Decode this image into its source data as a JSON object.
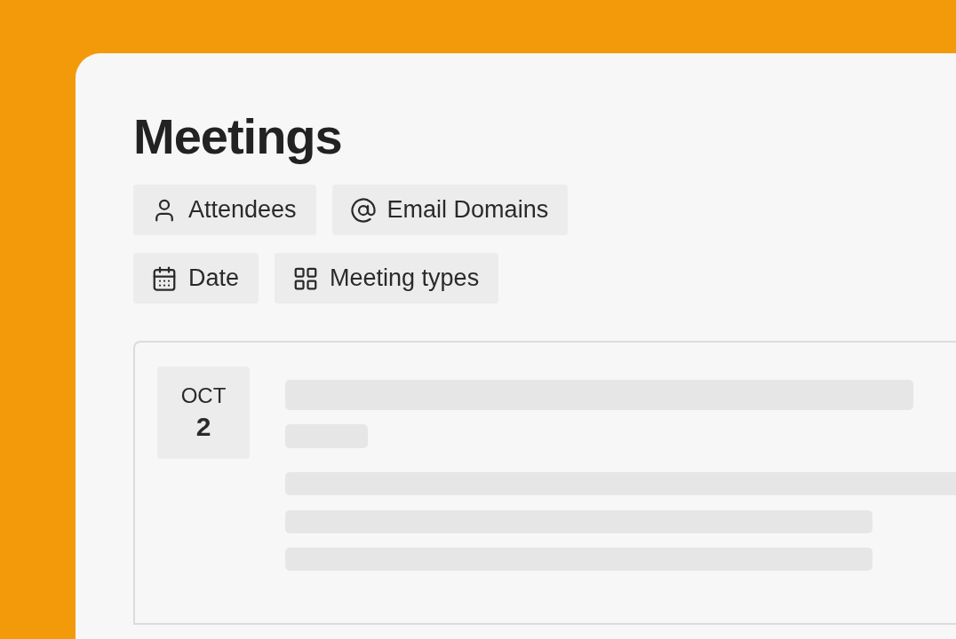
{
  "title": "Meetings",
  "filters": [
    [
      {
        "label": "Attendees",
        "kind": "person"
      },
      {
        "label": "Email Domains",
        "kind": "at"
      }
    ],
    [
      {
        "label": "Date",
        "kind": "calendar"
      },
      {
        "label": "Meeting types",
        "kind": "grid"
      }
    ]
  ],
  "meeting": {
    "month": "OCT",
    "day": "2"
  }
}
